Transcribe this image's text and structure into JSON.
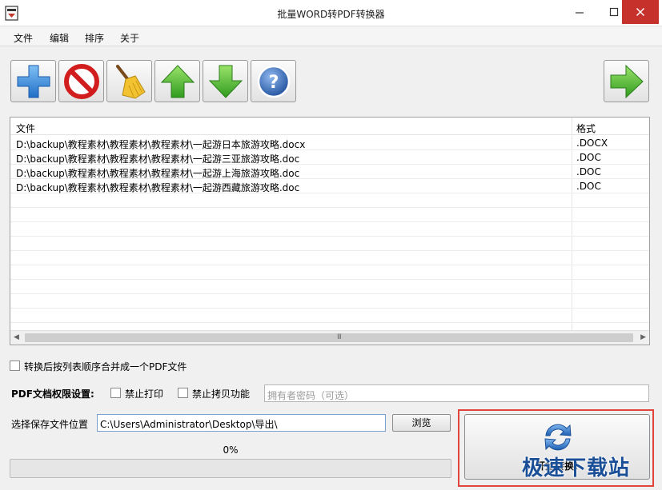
{
  "window": {
    "title": "批量WORD转PDF转换器"
  },
  "menu": {
    "items": [
      "文件",
      "编辑",
      "排序",
      "关于"
    ]
  },
  "toolbar": {
    "buttons": [
      "plus-icon",
      "prohibit-icon",
      "broom-icon",
      "arrow-up-icon",
      "arrow-down-icon",
      "help-icon",
      "arrow-right-icon"
    ]
  },
  "file_list": {
    "columns": [
      "文件",
      "格式"
    ],
    "rows": [
      {
        "path": "D:\\backup\\教程素材\\教程素材\\教程素材\\一起游日本旅游攻略.docx",
        "format": ".DOCX"
      },
      {
        "path": "D:\\backup\\教程素材\\教程素材\\教程素材\\一起游三亚旅游攻略.doc",
        "format": ".DOC"
      },
      {
        "path": "D:\\backup\\教程素材\\教程素材\\教程素材\\一起游上海旅游攻略.doc",
        "format": ".DOC"
      },
      {
        "path": "D:\\backup\\教程素材\\教程素材\\教程素材\\一起游西藏旅游攻略.doc",
        "format": ".DOC"
      }
    ],
    "scroll_grip": "III"
  },
  "options": {
    "merge_label": "转换后按列表顺序合并成一个PDF文件",
    "merge_checked": false,
    "permissions_label": "PDF文档权限设置:",
    "no_print_label": "禁止打印",
    "no_print_checked": false,
    "no_copy_label": "禁止拷贝功能",
    "no_copy_checked": false,
    "owner_password_placeholder": "拥有者密码（可选）"
  },
  "output": {
    "label": "选择保存文件位置",
    "path": "C:\\Users\\Administrator\\Desktop\\导出\\",
    "browse_label": "浏览"
  },
  "progress": {
    "percent_text": "0%",
    "value": 0
  },
  "start": {
    "label": "开始转换!"
  },
  "watermark": {
    "text": "极速下载站"
  },
  "colors": {
    "highlight": "#e0443a",
    "close": "#c7312b",
    "watermark": "#1a4f97"
  }
}
